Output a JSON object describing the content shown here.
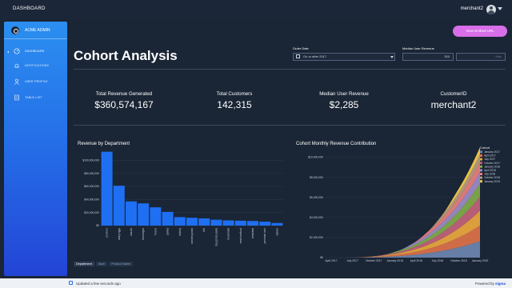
{
  "topbar": {
    "title": "DASHBOARD",
    "user": "merchant2"
  },
  "sidebar": {
    "brand": "ACME ADMIN",
    "items": [
      {
        "label": "DASHBOARD",
        "icon": "dashboard-icon",
        "active": true
      },
      {
        "label": "NOTIFICATIONS",
        "icon": "bell-icon",
        "active": false
      },
      {
        "label": "USER PROFILE",
        "icon": "user-icon",
        "active": false
      },
      {
        "label": "TABLE LIST",
        "icon": "table-icon",
        "active": false
      }
    ]
  },
  "page": {
    "title": "Cohort Analysis",
    "embed_button": "View Embed URL"
  },
  "filters": {
    "order_date_label": "Order Date",
    "order_date_value": "On or after 2017",
    "median_label": "Median User Revenue",
    "median_min": "300",
    "median_max_placeholder": "Max"
  },
  "kpis": [
    {
      "label": "Total Revenue Generated",
      "value": "$360,574,167"
    },
    {
      "label": "Total Customers",
      "value": "142,315"
    },
    {
      "label": "Median User Revenue",
      "value": "$2,285"
    },
    {
      "label": "CustomerID",
      "value": "merchant2"
    }
  ],
  "charts": {
    "bar_title": "Revenue by Department",
    "area_title": "Cohort Monthly Revenue Contribution"
  },
  "breadcrumb": [
    "Department",
    "Aisle",
    "Product Name"
  ],
  "status": {
    "updated": "Updated a few seconds ago",
    "powered_prefix": "Powered by",
    "powered_brand": "sigma"
  },
  "chart_data": [
    {
      "type": "bar",
      "title": "Revenue by Department",
      "categories": [
        "produce",
        "dairy eggs",
        "snacks",
        "beverages",
        "frozen",
        "pantry",
        "bakery",
        "canned goods",
        "deli",
        "dry goods pasta",
        "household",
        "meat seafood",
        "breakfast",
        "personal care",
        "babies"
      ],
      "values": [
        113000000,
        61000000,
        37000000,
        34000000,
        28000000,
        21000000,
        13000000,
        12000000,
        11000000,
        9000000,
        8000000,
        7500000,
        7000000,
        6000000,
        4000000
      ],
      "yticks": [
        "$0",
        "$20,000,000",
        "$40,000,000",
        "$60,000,000",
        "$80,000,000",
        "$100,000,000"
      ],
      "ylim": [
        0,
        115000000
      ],
      "color": "#1f6ff2"
    },
    {
      "type": "area",
      "title": "Cohort Monthly Revenue Contribution",
      "x": [
        "April 2017",
        "July 2017",
        "October 2017",
        "January 2018",
        "April 2018",
        "July 2018",
        "October 2018",
        "January 2019"
      ],
      "yticks": [
        "$0",
        "$2,000,000",
        "$4,000,000",
        "$6,000,000",
        "$8,000,000",
        "$10,000,000"
      ],
      "ylim": [
        0,
        11000000
      ],
      "legend_title": "Cohort",
      "legend_position": "right",
      "series": [
        {
          "name": "January 2017",
          "color": "#6b83ad",
          "weight": 1.0
        },
        {
          "name": "April 2017",
          "color": "#d9704a",
          "weight": 0.95
        },
        {
          "name": "July 2017",
          "color": "#e7a33e",
          "weight": 0.9
        },
        {
          "name": "October 2017",
          "color": "#c0607a",
          "weight": 0.85
        },
        {
          "name": "January 2018",
          "color": "#7fa84a",
          "weight": 0.8
        },
        {
          "name": "April 2018",
          "color": "#9a8ac4",
          "weight": 0.7
        },
        {
          "name": "July 2018",
          "color": "#e87c7c",
          "weight": 0.6
        },
        {
          "name": "October 2018",
          "color": "#b69a7a",
          "weight": 0.5
        },
        {
          "name": "January 2019",
          "color": "#f2c84a",
          "weight": 0.4
        }
      ]
    }
  ]
}
